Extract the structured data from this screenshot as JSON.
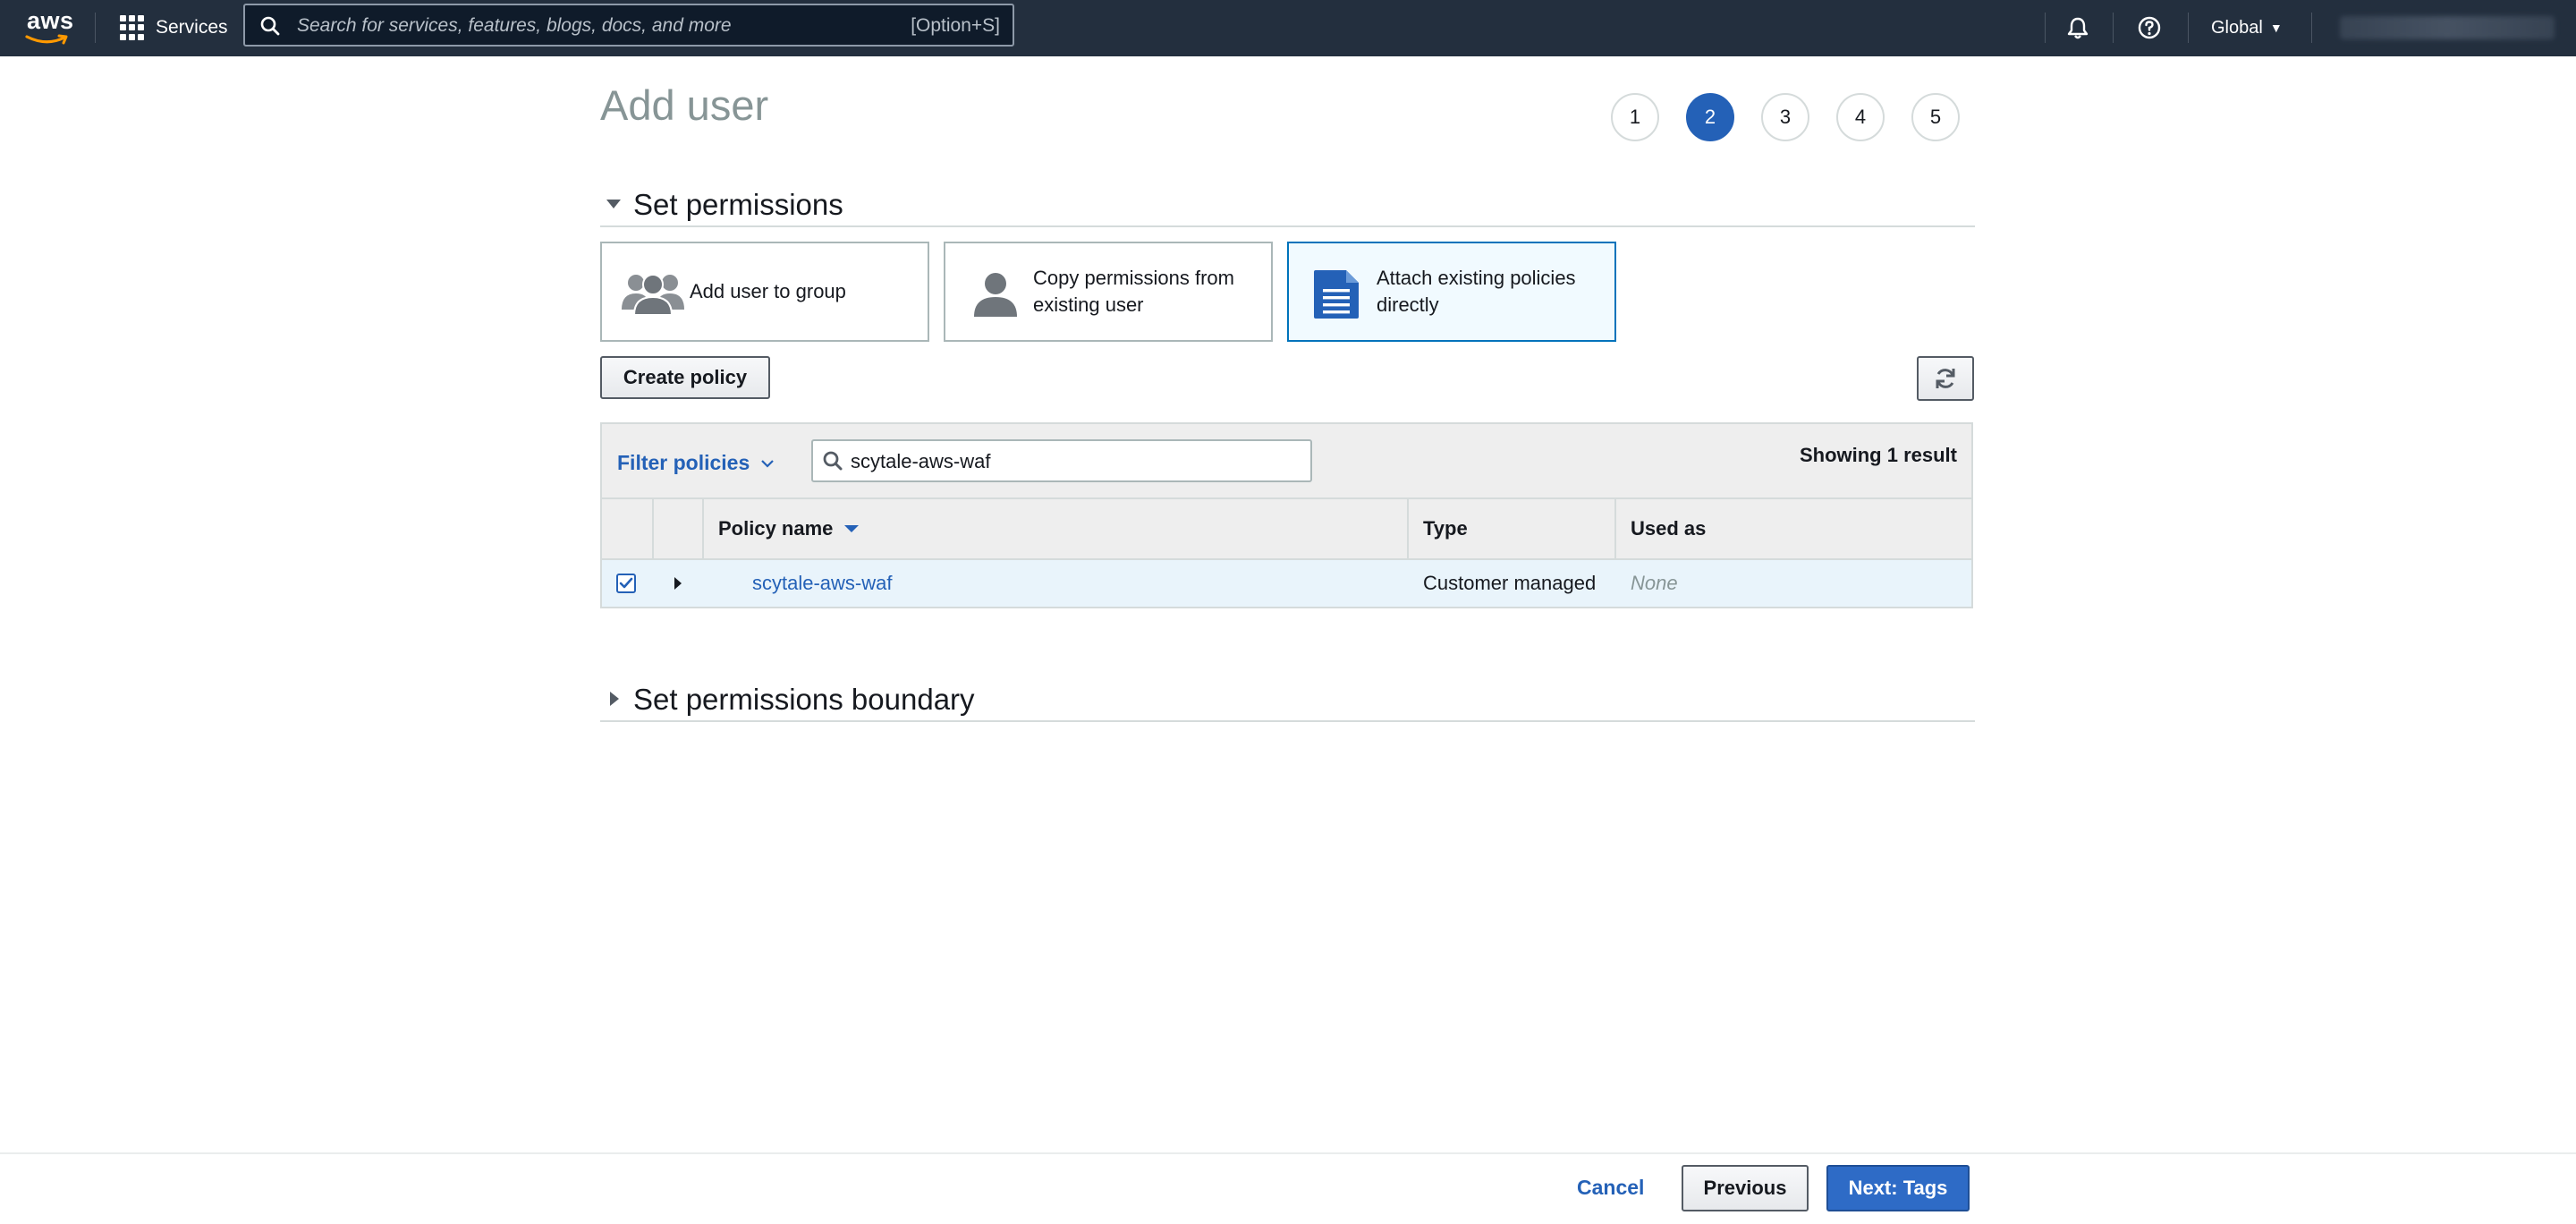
{
  "topnav": {
    "logo_text": "aws",
    "services_label": "Services",
    "search_placeholder": "Search for services, features, blogs, docs, and more",
    "search_shortcut": "[Option+S]",
    "region_label": "Global"
  },
  "header": {
    "title": "Add user",
    "steps": [
      "1",
      "2",
      "3",
      "4",
      "5"
    ],
    "active_step": "2"
  },
  "permissions": {
    "section_title": "Set permissions",
    "options": [
      {
        "label": "Add user to group",
        "selected": false
      },
      {
        "label": "Copy permissions from existing user",
        "selected": false
      },
      {
        "label": "Attach existing policies directly",
        "selected": true
      }
    ],
    "create_policy_label": "Create policy",
    "filter_label": "Filter policies",
    "search_value": "scytale-aws-waf",
    "result_count": "Showing 1 result",
    "columns": [
      "Policy name",
      "Type",
      "Used as"
    ],
    "rows": [
      {
        "name": "scytale-aws-waf",
        "type": "Customer managed",
        "used_as": "None",
        "checked": true
      }
    ]
  },
  "boundary": {
    "section_title": "Set permissions boundary"
  },
  "footer": {
    "cancel_label": "Cancel",
    "previous_label": "Previous",
    "next_label": "Next: Tags"
  },
  "colors": {
    "nav_bg": "#232f3e",
    "accent_blue": "#2461b7",
    "selected_bg": "#f1faff",
    "row_highlight": "#e9f4fb",
    "title_grey": "#879596"
  }
}
